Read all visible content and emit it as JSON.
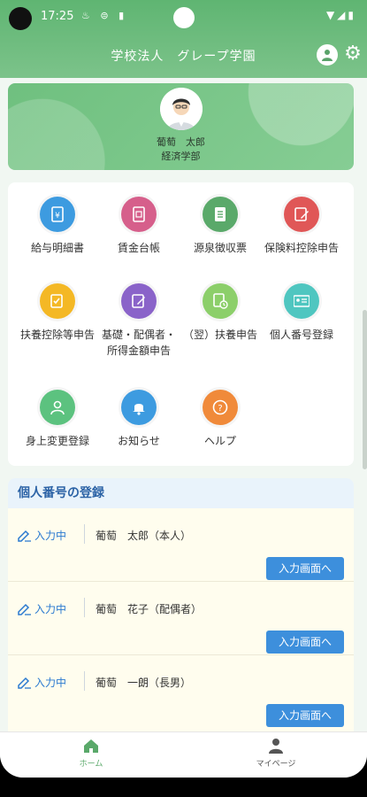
{
  "status_bar": {
    "time": "17:25",
    "left_icons": "♨ ⊜ ▮",
    "right_icons": "▼◢▮"
  },
  "header": {
    "title": "学校法人　グレープ学園"
  },
  "profile": {
    "name": "葡萄　太郎",
    "department": "経済学部"
  },
  "menu": {
    "items": [
      {
        "label": "給与明細書",
        "color": "#3d9be0",
        "icon": "yen-doc-icon"
      },
      {
        "label": "賃金台帳",
        "color": "#d65f8b",
        "icon": "ledger-icon"
      },
      {
        "label": "源泉徴収票",
        "color": "#5aa96a",
        "icon": "list-doc-icon"
      },
      {
        "label": "保険料控除申告",
        "color": "#e05757",
        "icon": "form-pen-icon"
      },
      {
        "label": "扶養控除等申告",
        "color": "#f4b825",
        "icon": "form-check-icon"
      },
      {
        "label": "基礎・配偶者・所得金額申告",
        "color": "#8a63c9",
        "icon": "doc-pen-icon"
      },
      {
        "label": "（翌）扶養申告",
        "color": "#8ccf6a",
        "icon": "doc-clock-icon"
      },
      {
        "label": "個人番号登録",
        "color": "#4fc6c0",
        "icon": "id-card-icon"
      },
      {
        "label": "身上変更登録",
        "color": "#5cc27f",
        "icon": "person-icon"
      },
      {
        "label": "お知らせ",
        "color": "#3d9be0",
        "icon": "bell-icon"
      },
      {
        "label": "ヘルプ",
        "color": "#f08a3a",
        "icon": "help-icon"
      }
    ]
  },
  "section": {
    "title": "個人番号の登録",
    "rows": [
      {
        "status": "入力中",
        "name": "葡萄　太郎（本人）",
        "button": "入力画面へ"
      },
      {
        "status": "入力中",
        "name": "葡萄　花子（配偶者）",
        "button": "入力画面へ"
      },
      {
        "status": "入力中",
        "name": "葡萄　一朗（長男）",
        "button": "入力画面へ"
      }
    ]
  },
  "bottom_nav": {
    "home": "ホーム",
    "mypage": "マイページ"
  },
  "colors": {
    "brand_green": "#5fb572",
    "link_blue": "#3d8fdc"
  }
}
